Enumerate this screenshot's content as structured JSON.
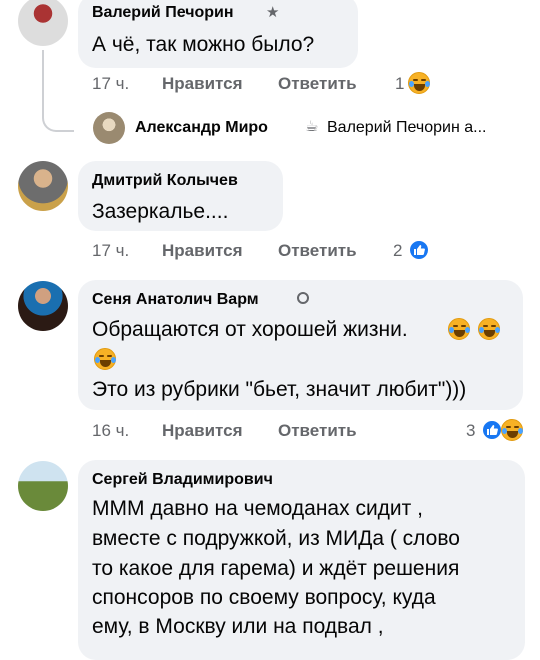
{
  "labels": {
    "like": "Нравится",
    "reply": "Ответить"
  },
  "comments": [
    {
      "author": "Валерий Печорин",
      "text": [
        "А чё, так можно было?"
      ],
      "time": "17 ч.",
      "reactions_count": "1"
    },
    {
      "author": "Дмитрий Колычев",
      "text": [
        "Зазеркалье...."
      ],
      "time": "17 ч.",
      "reactions_count": "2"
    },
    {
      "author": "Сеня Анатолич Варм",
      "text": [
        "Обращаются от хорошей жизни.",
        "Это из рубрики \"бьет, значит любит\")))"
      ],
      "time": "16 ч.",
      "reactions_count": "3"
    },
    {
      "author": "Сергей Владимирович",
      "text": [
        "МММ давно на чемоданах сидит ,",
        "вместе с подружкой, из МИДа ( слово",
        "то какое для гарема) и ждёт решения",
        "спонсоров по своему вопросу, куда",
        "ему, в Москву или на подвал ,"
      ]
    }
  ],
  "reply_preview": {
    "author": "Александр Миро",
    "text": "Валерий Печорин а..."
  },
  "colors": {
    "bubble": "#f0f2f5",
    "meta": "#65676b",
    "like_blue": "#1877f2",
    "haha": "#f7b125"
  }
}
